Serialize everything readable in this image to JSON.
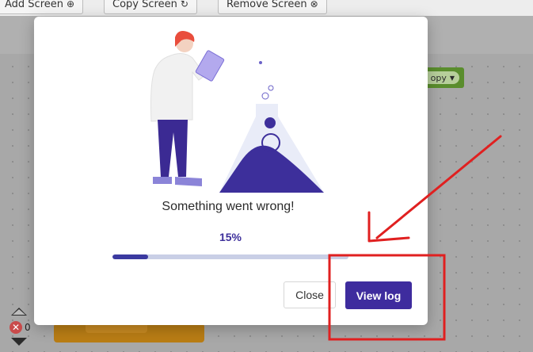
{
  "toolbar": {
    "buttons": [
      {
        "label": "Add Screen",
        "icon": "plus-circle-icon"
      },
      {
        "label": "Copy Screen",
        "icon": "copy-circle-icon"
      },
      {
        "label": "Remove Screen",
        "icon": "x-circle-icon"
      }
    ]
  },
  "workspace": {
    "block_label": "opy",
    "error_count": "0"
  },
  "dialog": {
    "message": "Something went wrong!",
    "progress_text": "15%",
    "progress_value": 0.15,
    "close_label": "Close",
    "view_log_label": "View log"
  },
  "colors": {
    "accent": "#3e2c9e",
    "progress_track": "#c9cfe6",
    "annotation": "#e02020"
  }
}
